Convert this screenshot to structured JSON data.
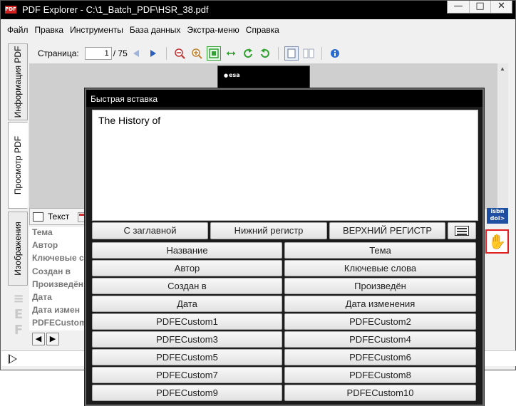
{
  "window": {
    "title": "PDF Explorer - C:\\1_Batch_PDF\\HSR_38.pdf",
    "app_icon_text": "PDF",
    "controls": {
      "minimize": "—",
      "maximize": "□",
      "close": "✕"
    }
  },
  "menu": [
    "Файл",
    "Правка",
    "Инструменты",
    "База данных",
    "Экстра-меню",
    "Справка"
  ],
  "vertical_tabs": [
    "Информация PDF",
    "Просмотр PDF",
    "Изображения"
  ],
  "toolbar": {
    "page_label": "Страница:",
    "page_current": "1",
    "page_total": "/ 75",
    "icons": [
      "prev-page-icon",
      "next-page-icon",
      "zoom-out-icon",
      "zoom-in-icon",
      "fit-page-icon",
      "fit-width-icon",
      "rotate-ccw-icon",
      "rotate-cw-icon",
      "single-page-icon",
      "two-page-icon",
      "info-icon"
    ]
  },
  "viewer": {
    "logo_text": "esa"
  },
  "properties": {
    "tab_label": "Текст",
    "fields": [
      "Тема",
      "Автор",
      "Ключевые с",
      "Создан в",
      "Произведён",
      "Дата",
      "Дата измен",
      "PDFECustom"
    ]
  },
  "side": {
    "isbn_top": "isbn",
    "isbn_bottom": "doi>"
  },
  "dialog": {
    "title": "Быстрая вставка",
    "text_value": "The History of",
    "case_buttons": [
      "С заглавной",
      "Нижний регистр",
      "ВЕРХНИЙ РЕГИСТР"
    ],
    "field_buttons": [
      [
        "Название",
        "Тема"
      ],
      [
        "Автор",
        "Ключевые слова"
      ],
      [
        "Создан в",
        "Произведён"
      ],
      [
        "Дата",
        "Дата изменения"
      ],
      [
        "PDFECustom1",
        "PDFECustom2"
      ],
      [
        "PDFECustom3",
        "PDFECustom4"
      ],
      [
        "PDFECustom5",
        "PDFECustom6"
      ],
      [
        "PDFECustom7",
        "PDFECustom8"
      ],
      [
        "PDFECustom9",
        "PDFECustom10"
      ]
    ]
  },
  "colors": {
    "titlebar": "#000000",
    "accent_red": "#e02020",
    "info_blue": "#1f4fa0"
  }
}
